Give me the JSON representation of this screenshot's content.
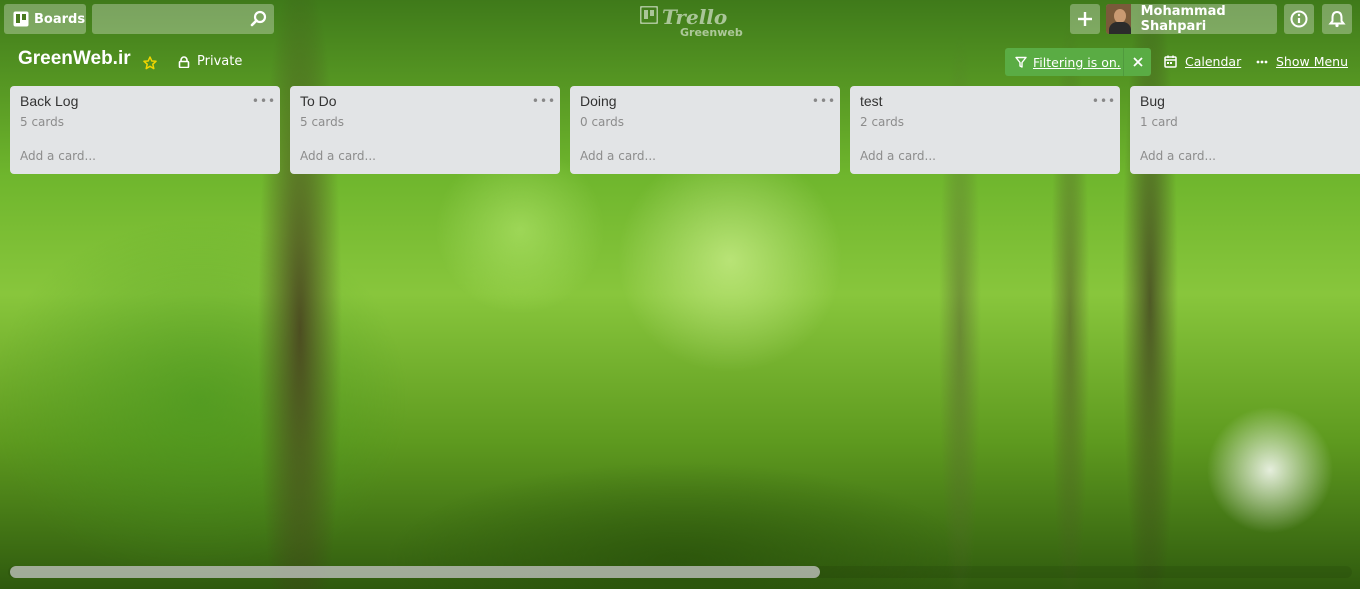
{
  "header": {
    "boards_label": "Boards",
    "search_value": "",
    "logo_text": "Trello",
    "logo_subtext": "Greenweb",
    "user_name": "Mohammad Shahpari"
  },
  "board": {
    "title": "GreenWeb.ir",
    "visibility": "Private",
    "filter_label": "Filtering is on.",
    "calendar_label": "Calendar",
    "show_menu_label": "Show Menu"
  },
  "lists": [
    {
      "name": "Back Log",
      "count": "5 cards",
      "add": "Add a card..."
    },
    {
      "name": "To Do",
      "count": "5 cards",
      "add": "Add a card..."
    },
    {
      "name": "Doing",
      "count": "0 cards",
      "add": "Add a card..."
    },
    {
      "name": "test",
      "count": "2 cards",
      "add": "Add a card..."
    },
    {
      "name": "Bug",
      "count": "1 card",
      "add": "Add a card..."
    }
  ],
  "colors": {
    "filter_green": "#5aac44",
    "list_bg": "#e2e4e6",
    "star_yellow": "#f2d600"
  },
  "icons": {
    "boards": "trello-board-icon",
    "search": "search-icon",
    "add": "plus-icon",
    "info": "info-icon",
    "notifications": "bell-icon",
    "star": "star-icon",
    "lock": "lock-icon",
    "filter": "filter-icon",
    "calendar": "calendar-icon",
    "menu": "ellipsis-icon"
  }
}
